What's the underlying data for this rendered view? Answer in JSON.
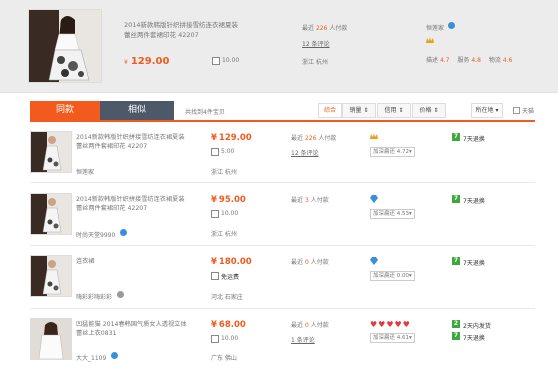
{
  "colors": {
    "accent": "#f25a1e",
    "tab_dark": "#4d5969",
    "green": "#3da83c",
    "blue": "#3a8fd9",
    "top_bg": "#ececec"
  },
  "top": {
    "title_line1": "2014新款韩版针织拼接雪纺连衣裙夏装",
    "title_line2": "蕾丝两件套裙印花 42207",
    "price": "129.00",
    "currency": "¥",
    "box_count": "10.00",
    "recent_label": "最近",
    "recent_count": "226",
    "recent_suffix": "人付款",
    "reviews": "12 条评论",
    "location": "浙江 杭州",
    "seller": "恒莲家",
    "rating_desc_label": "描述",
    "rating_desc": "4.7",
    "rating_service_label": "服务",
    "rating_service": "4.8",
    "rating_ship_label": "物流",
    "rating_ship": "4.6"
  },
  "tabs": {
    "same": "同款",
    "similar": "相似",
    "hint": "共找到4件宝贝"
  },
  "sort": {
    "overall": "综合",
    "sales": "销量",
    "credit": "信用",
    "price": "价格",
    "location": "所在地",
    "tmall": "天猫"
  },
  "rows": [
    {
      "title1": "2014新款韩版针织拼接雪纺连衣裙夏装",
      "title2": "蕾丝两件套裙印花 42207",
      "seller": "恒莲家",
      "price": "129.00",
      "box": "5.00",
      "recent_label": "最近",
      "recent_count": "226",
      "recent_suffix": "人付款",
      "reviews": "12 条评论",
      "location": "浙江 杭州",
      "compare": "加深扁还 4.72▾",
      "service": "7天退换"
    },
    {
      "title1": "2014新款韩版针织拼接雪纺连衣裙夏装",
      "title2": "蕾丝两件套裙印花 42207",
      "seller": "时尚天堂9990",
      "price": "95.00",
      "box": "10.00",
      "recent_label": "最近",
      "recent_count": "3",
      "recent_suffix": "人付款",
      "reviews": "",
      "location": "浙江 杭州",
      "compare": "加深扁还 4.53▾",
      "service": "7天退换"
    },
    {
      "title1": "连衣裙",
      "title2": "",
      "seller": "嗨彩彩嗨彩彩",
      "price": "180.00",
      "box": "免运费",
      "recent_label": "最近",
      "recent_count": "0",
      "recent_suffix": "人付款",
      "reviews": "",
      "location": "河北 石家庄",
      "compare": "加深扁还 0.00▾",
      "service": "7天退换"
    },
    {
      "title1": "凹猛能猫 2014春韩国气质女人透视立体",
      "title2": "蕾丝上衣0831",
      "seller": "大大_1109",
      "price": "68.00",
      "box": "10.00",
      "recent_label": "最近",
      "recent_count": "0",
      "recent_suffix": "人付款",
      "reviews": "1 条评论",
      "location": "广东 佛山",
      "compare": "加深扁还 4.61▾",
      "service": "2天内发货",
      "service2": "7天退换"
    }
  ]
}
